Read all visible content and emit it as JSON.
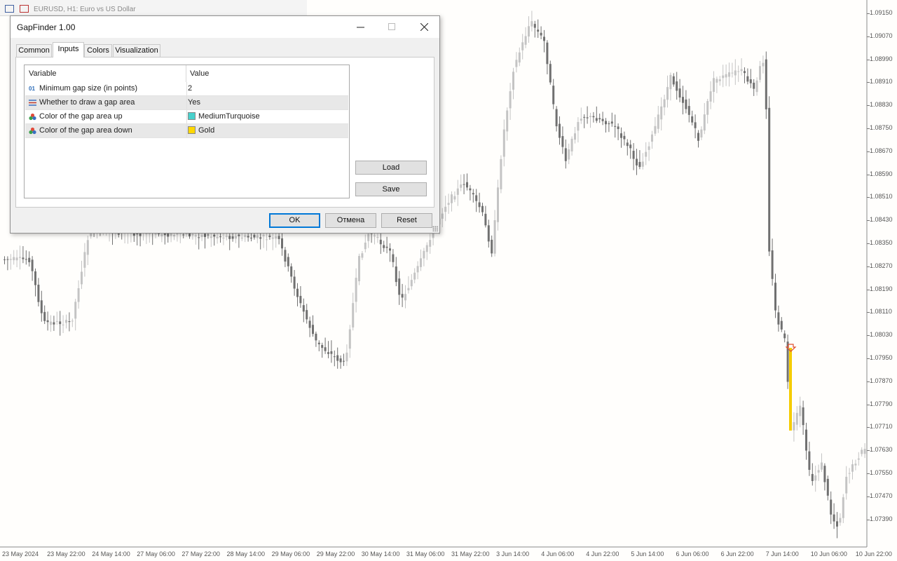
{
  "chart": {
    "window_title": "EURUSD, H1:  Euro vs US Dollar",
    "price_labels": [
      "1.09150",
      "1.09070",
      "1.08990",
      "1.08910",
      "1.08830",
      "1.08750",
      "1.08670",
      "1.08590",
      "1.08510",
      "1.08430",
      "1.08350",
      "1.08270",
      "1.08190",
      "1.08110",
      "1.08030",
      "1.07950",
      "1.07870",
      "1.07790",
      "1.07710",
      "1.07630",
      "1.07550",
      "1.07470",
      "1.07390"
    ],
    "time_labels": [
      "23 May 2024",
      "23 May 22:00",
      "24 May 14:00",
      "27 May 06:00",
      "27 May 22:00",
      "28 May 14:00",
      "29 May 06:00",
      "29 May 22:00",
      "30 May 14:00",
      "31 May 06:00",
      "31 May 22:00",
      "3 Jun 14:00",
      "4 Jun 06:00",
      "4 Jun 22:00",
      "5 Jun 14:00",
      "6 Jun 06:00",
      "6 Jun 22:00",
      "7 Jun 14:00",
      "10 Jun 06:00",
      "10 Jun 22:00"
    ],
    "colors": {
      "candle_up": "#c4c4c4",
      "candle_down": "#707070",
      "gap_down": "#f5cc00",
      "gap_marker": "#e05030",
      "background": "#fffefc"
    }
  },
  "dialog": {
    "title": "GapFinder 1.00",
    "tabs": [
      {
        "label": "Common",
        "active": false
      },
      {
        "label": "Inputs",
        "active": true
      },
      {
        "label": "Colors",
        "active": false
      },
      {
        "label": "Visualization",
        "active": false
      }
    ],
    "table": {
      "headers": [
        "Variable",
        "Value"
      ],
      "rows": [
        {
          "icon": "number-icon",
          "icon_text": "01",
          "name": "Minimum gap size (in points)",
          "value": "2",
          "swatch": null
        },
        {
          "icon": "bool-icon",
          "icon_text": "",
          "name": "Whether to draw a gap area",
          "value": "Yes",
          "swatch": null
        },
        {
          "icon": "color-icon",
          "icon_text": "",
          "name": "Color of the gap area up",
          "value": "MediumTurquoise",
          "swatch": "#48d1cc"
        },
        {
          "icon": "color-icon",
          "icon_text": "",
          "name": "Color of the gap area down",
          "value": "Gold",
          "swatch": "#ffd700"
        }
      ]
    },
    "side_buttons": {
      "load": "Load",
      "save": "Save"
    },
    "buttons": {
      "ok": "OK",
      "cancel": "Отмена",
      "reset": "Reset"
    },
    "window_controls": {
      "minimize": "—",
      "maximize": "☐",
      "close": "✕"
    }
  }
}
